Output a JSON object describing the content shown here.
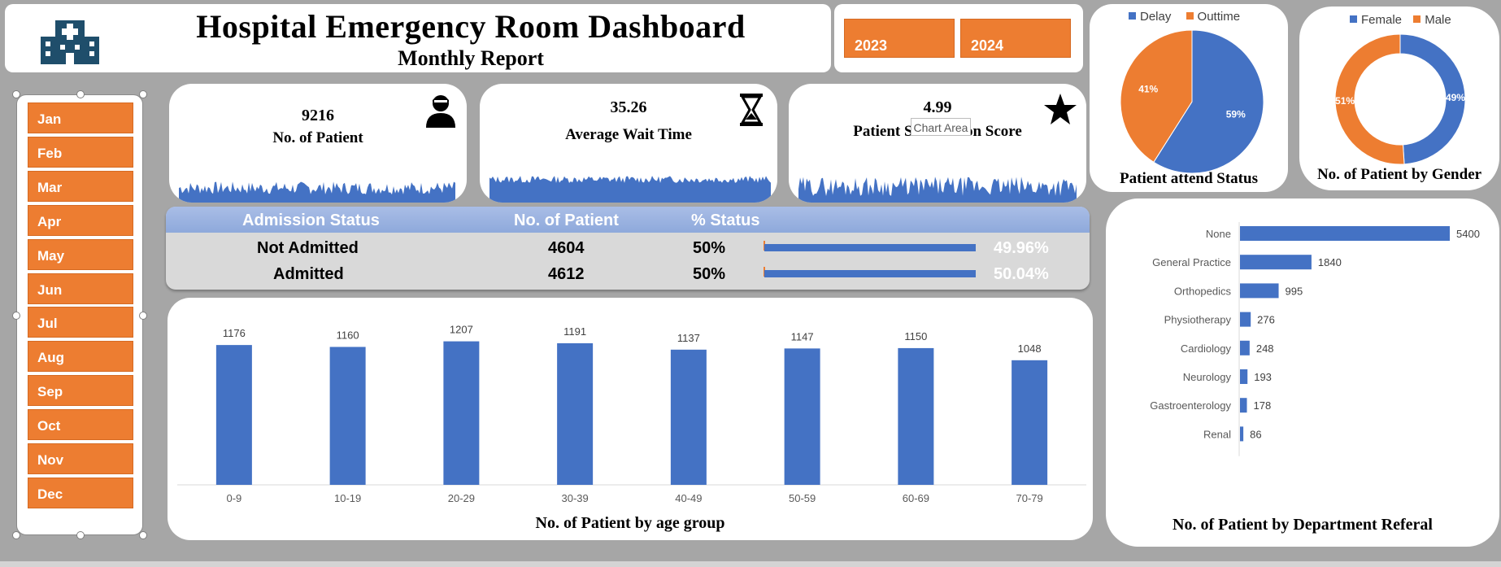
{
  "header": {
    "title": "Hospital Emergency Room Dashboard",
    "subtitle": "Monthly Report",
    "icon": "hospital-icon"
  },
  "years": [
    "2023",
    "2024"
  ],
  "months": [
    "Jan",
    "Feb",
    "Mar",
    "Apr",
    "May",
    "Jun",
    "Jul",
    "Aug",
    "Sep",
    "Oct",
    "Nov",
    "Dec"
  ],
  "kpis": [
    {
      "value": "9216",
      "label": "No. of Patient",
      "icon": "patient-icon"
    },
    {
      "value": "35.26",
      "label": "Average Wait Time",
      "icon": "hourglass-icon"
    },
    {
      "value": "4.99",
      "label": "Patient Satisfaction Score",
      "icon": "star-icon"
    }
  ],
  "tooltip": "Chart Area",
  "admission": {
    "headers": [
      "Admission Status",
      "No. of Patient",
      "% Status"
    ],
    "rows": [
      {
        "status": "Not Admitted",
        "count": "4604",
        "pct": "50%",
        "bar_label": "49.96%",
        "fraction": 0.4996
      },
      {
        "status": "Admitted",
        "count": "4612",
        "pct": "50%",
        "bar_label": "50.04%",
        "fraction": 0.5004
      }
    ]
  },
  "colors": {
    "blue": "#4472c4",
    "orange": "#ed7d31"
  },
  "chart_data": [
    {
      "type": "bar",
      "title": "No. of Patient by age group",
      "categories": [
        "0-9",
        "10-19",
        "20-29",
        "30-39",
        "40-49",
        "50-59",
        "60-69",
        "70-79"
      ],
      "values": [
        1176,
        1160,
        1207,
        1191,
        1137,
        1147,
        1150,
        1048
      ]
    },
    {
      "type": "pie",
      "title": "Patient attend Status",
      "legend_position": "top",
      "series": [
        {
          "name": "Delay",
          "value": 59,
          "label": "59%",
          "color": "#4472c4"
        },
        {
          "name": "Outtime",
          "value": 41,
          "label": "41%",
          "color": "#ed7d31"
        }
      ]
    },
    {
      "type": "pie",
      "subtype": "donut",
      "title": "No. of Patient by Gender",
      "legend_position": "top",
      "series": [
        {
          "name": "Female",
          "value": 49,
          "label": "49%",
          "color": "#4472c4"
        },
        {
          "name": "Male",
          "value": 51,
          "label": "51%",
          "color": "#ed7d31"
        }
      ]
    },
    {
      "type": "bar",
      "orientation": "horizontal",
      "title": "No. of Patient by Department Referal",
      "categories": [
        "None",
        "General Practice",
        "Orthopedics",
        "Physiotherapy",
        "Cardiology",
        "Neurology",
        "Gastroenterology",
        "Renal"
      ],
      "values": [
        5400,
        1840,
        995,
        276,
        248,
        193,
        178,
        86
      ]
    }
  ]
}
